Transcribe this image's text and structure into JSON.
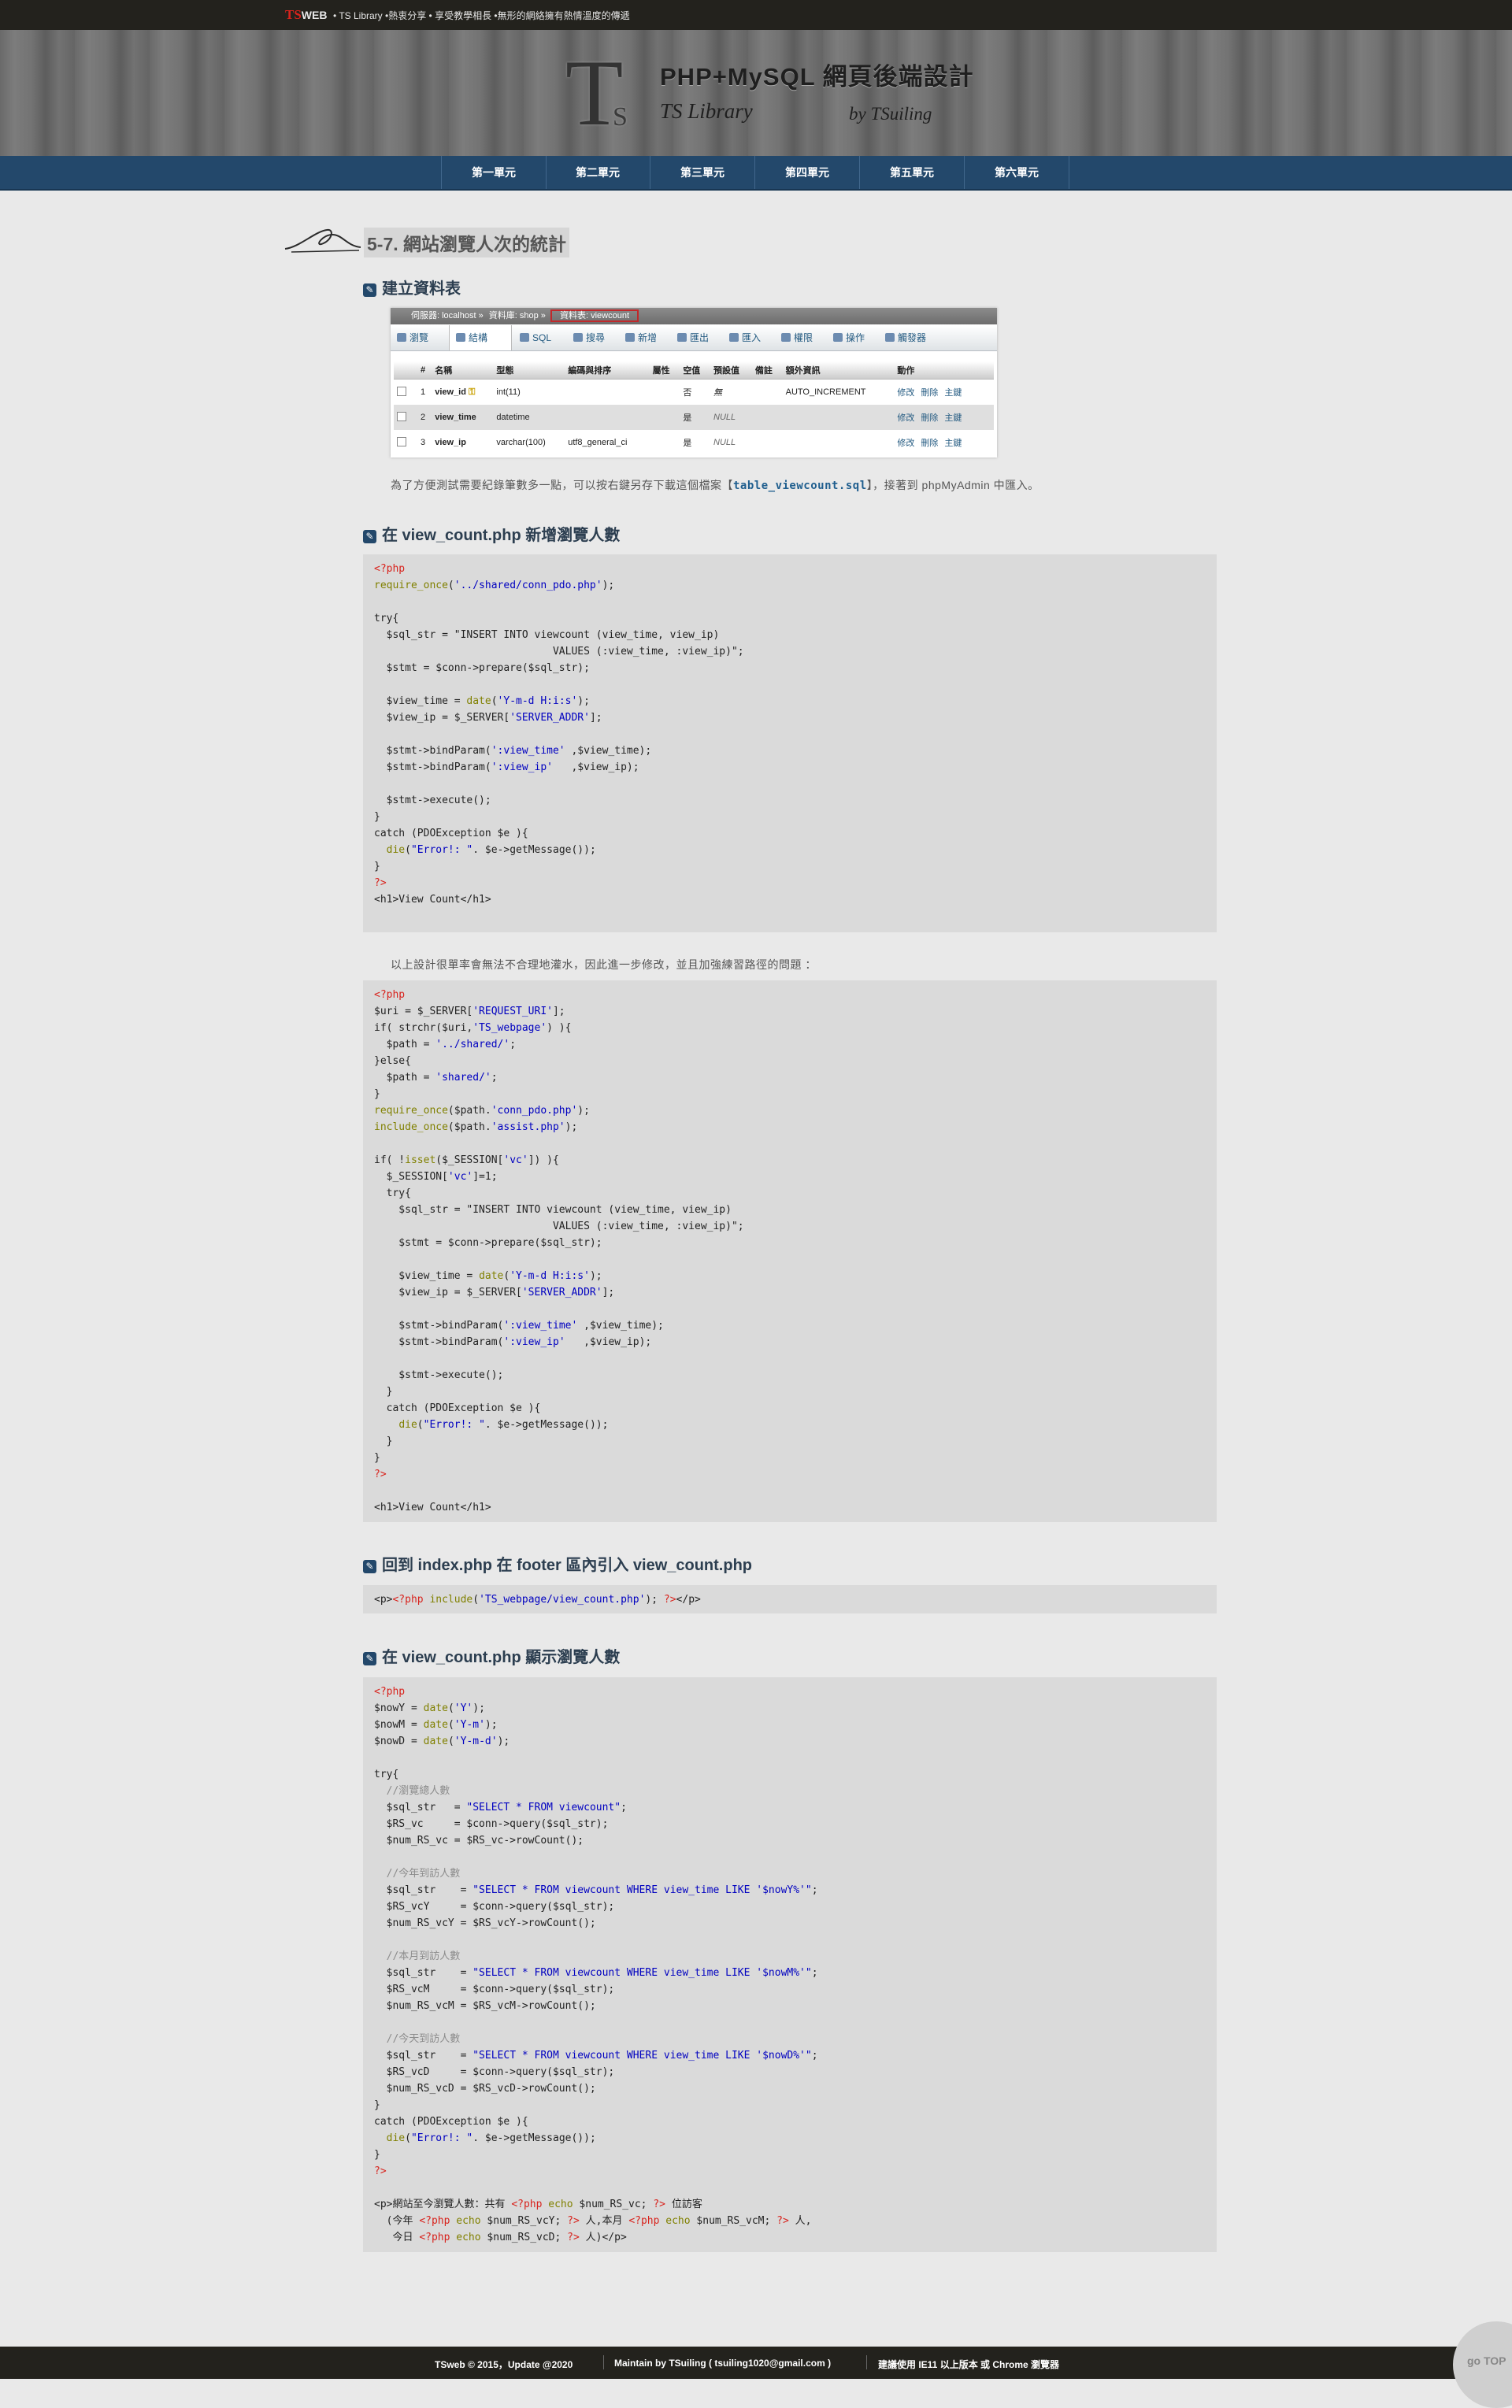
{
  "topbar": {
    "logo_ts": "TS",
    "logo_web": "WEB",
    "tagline": "• TS Library •熱衷分享 • 享受教學相長 •無形的網絡擁有熱情溫度的傳遞"
  },
  "banner": {
    "emblem_big": "T",
    "emblem_small": "S",
    "title": "PHP+MySQL 網頁後端設計",
    "subtitle": "TS Library",
    "byline": "by TSuiling"
  },
  "nav": {
    "items": [
      "第一單元",
      "第二單元",
      "第三單元",
      "第四單元",
      "第五單元",
      "第六單元"
    ]
  },
  "page": {
    "title": "5-7. 網站瀏覽人次的統計"
  },
  "sections": {
    "create_table": "建立資料表",
    "add_count": "在 view_count.php 新增瀏覽人數",
    "include_footer": "回到 index.php 在 footer 區內引入 view_count.php",
    "show_count": "在 view_count.php 顯示瀏覽人數"
  },
  "pma": {
    "crumbs": [
      "伺服器: localhost »",
      "資料庫: shop »",
      "資料表: viewcount"
    ],
    "tabs": [
      "瀏覽",
      "結構",
      "SQL",
      "搜尋",
      "新增",
      "匯出",
      "匯入",
      "權限",
      "操作",
      "觸發器"
    ],
    "headers": [
      "#",
      "名稱",
      "型態",
      "編碼與排序",
      "屬性",
      "空值",
      "預設值",
      "備註",
      "額外資訊",
      "動作"
    ],
    "rows": [
      {
        "no": "1",
        "name": "view_id",
        "type": "int(11)",
        "collation": "",
        "null": "否",
        "default": "無",
        "extra": "AUTO_INCREMENT"
      },
      {
        "no": "2",
        "name": "view_time",
        "type": "datetime",
        "collation": "",
        "null": "是",
        "default": "NULL",
        "extra": ""
      },
      {
        "no": "3",
        "name": "view_ip",
        "type": "varchar(100)",
        "collation": "utf8_general_ci",
        "null": "是",
        "default": "NULL",
        "extra": ""
      }
    ],
    "actions": [
      "修改",
      "刪除",
      "主鍵"
    ]
  },
  "notes": {
    "export_pre": "為了方便測試需要紀錄筆數多一點，可以按右鍵另存下載這個檔案【",
    "export_file": "table_viewcount.sql",
    "export_post": "】，接著到 phpMyAdmin 中匯入。",
    "improve": "以上設計很單率會無法不合理地灌水，因此進一步修改，並且加強練習路徑的問題 ："
  },
  "code": {
    "block1": "<?php\nrequire_once('../shared/conn_pdo.php');\n\ntry{\n  $sql_str = \"INSERT INTO viewcount (view_time, view_ip)\n                             VALUES (:view_time, :view_ip)\";\n  $stmt = $conn->prepare($sql_str);\n\n  $view_time = date('Y-m-d H:i:s');\n  $view_ip = $_SERVER['SERVER_ADDR'];\n\n  $stmt->bindParam(':view_time' ,$view_time);\n  $stmt->bindParam(':view_ip'   ,$view_ip);\n\n  $stmt->execute();\n}\ncatch (PDOException $e ){\n  die(\"Error!: \". $e->getMessage());\n}\n?>\n<h1>View Count</h1>",
    "block2": "<?php\n$uri = $_SERVER['REQUEST_URI'];\nif( strchr($uri,'TS_webpage') ){\n  $path = '../shared/';\n}else{\n  $path = 'shared/';\n}\nrequire_once($path.'conn_pdo.php');\ninclude_once($path.'assist.php');\n\nif( !isset($_SESSION['vc']) ){\n  $_SESSION['vc']=1;\n  try{\n    $sql_str = \"INSERT INTO viewcount (view_time, view_ip)\n                             VALUES (:view_time, :view_ip)\";\n    $stmt = $conn->prepare($sql_str);\n\n    $view_time = date('Y-m-d H:i:s');\n    $view_ip = $_SERVER['SERVER_ADDR'];\n\n    $stmt->bindParam(':view_time' ,$view_time);\n    $stmt->bindParam(':view_ip'   ,$view_ip);\n\n    $stmt->execute();\n  }\n  catch (PDOException $e ){\n    die(\"Error!: \". $e->getMessage());\n  }\n}\n?>\n\n<h1>View Count</h1>",
    "block3": "<p><?php include('TS_webpage/view_count.php'); ?></p>",
    "block4": "<?php\n$nowY = date('Y');\n$nowM = date('Y-m');\n$nowD = date('Y-m-d');\n\ntry{\n  //瀏覽總人數\n  $sql_str   = \"SELECT * FROM viewcount\";\n  $RS_vc     = $conn->query($sql_str);\n  $num_RS_vc = $RS_vc->rowCount();\n\n  //今年到訪人數\n  $sql_str    = \"SELECT * FROM viewcount WHERE view_time LIKE '$nowY%'\";\n  $RS_vcY     = $conn->query($sql_str);\n  $num_RS_vcY = $RS_vcY->rowCount();\n\n  //本月到訪人數\n  $sql_str    = \"SELECT * FROM viewcount WHERE view_time LIKE '$nowM%'\";\n  $RS_vcM     = $conn->query($sql_str);\n  $num_RS_vcM = $RS_vcM->rowCount();\n\n  //今天到訪人數\n  $sql_str    = \"SELECT * FROM viewcount WHERE view_time LIKE '$nowD%'\";\n  $RS_vcD     = $conn->query($sql_str);\n  $num_RS_vcD = $RS_vcD->rowCount();\n}\ncatch (PDOException $e ){\n  die(\"Error!: \". $e->getMessage());\n}\n?>\n\n<p>網站至今瀏覽人數：共有 <?php echo $num_RS_vc; ?> 位訪客\n  (今年 <?php echo $num_RS_vcY; ?> 人,本月 <?php echo $num_RS_vcM; ?> 人,\n   今日 <?php echo $num_RS_vcD; ?> 人)</p>"
  },
  "footer": {
    "copyright": "TSweb © 2015，Update @2020",
    "maintain": "Maintain by TSuiling ( tsuiling1020@gmail.com )",
    "browser": "建議使用 IE11 以上版本 或 Chrome 瀏覽器"
  },
  "gotop": "go TOP"
}
